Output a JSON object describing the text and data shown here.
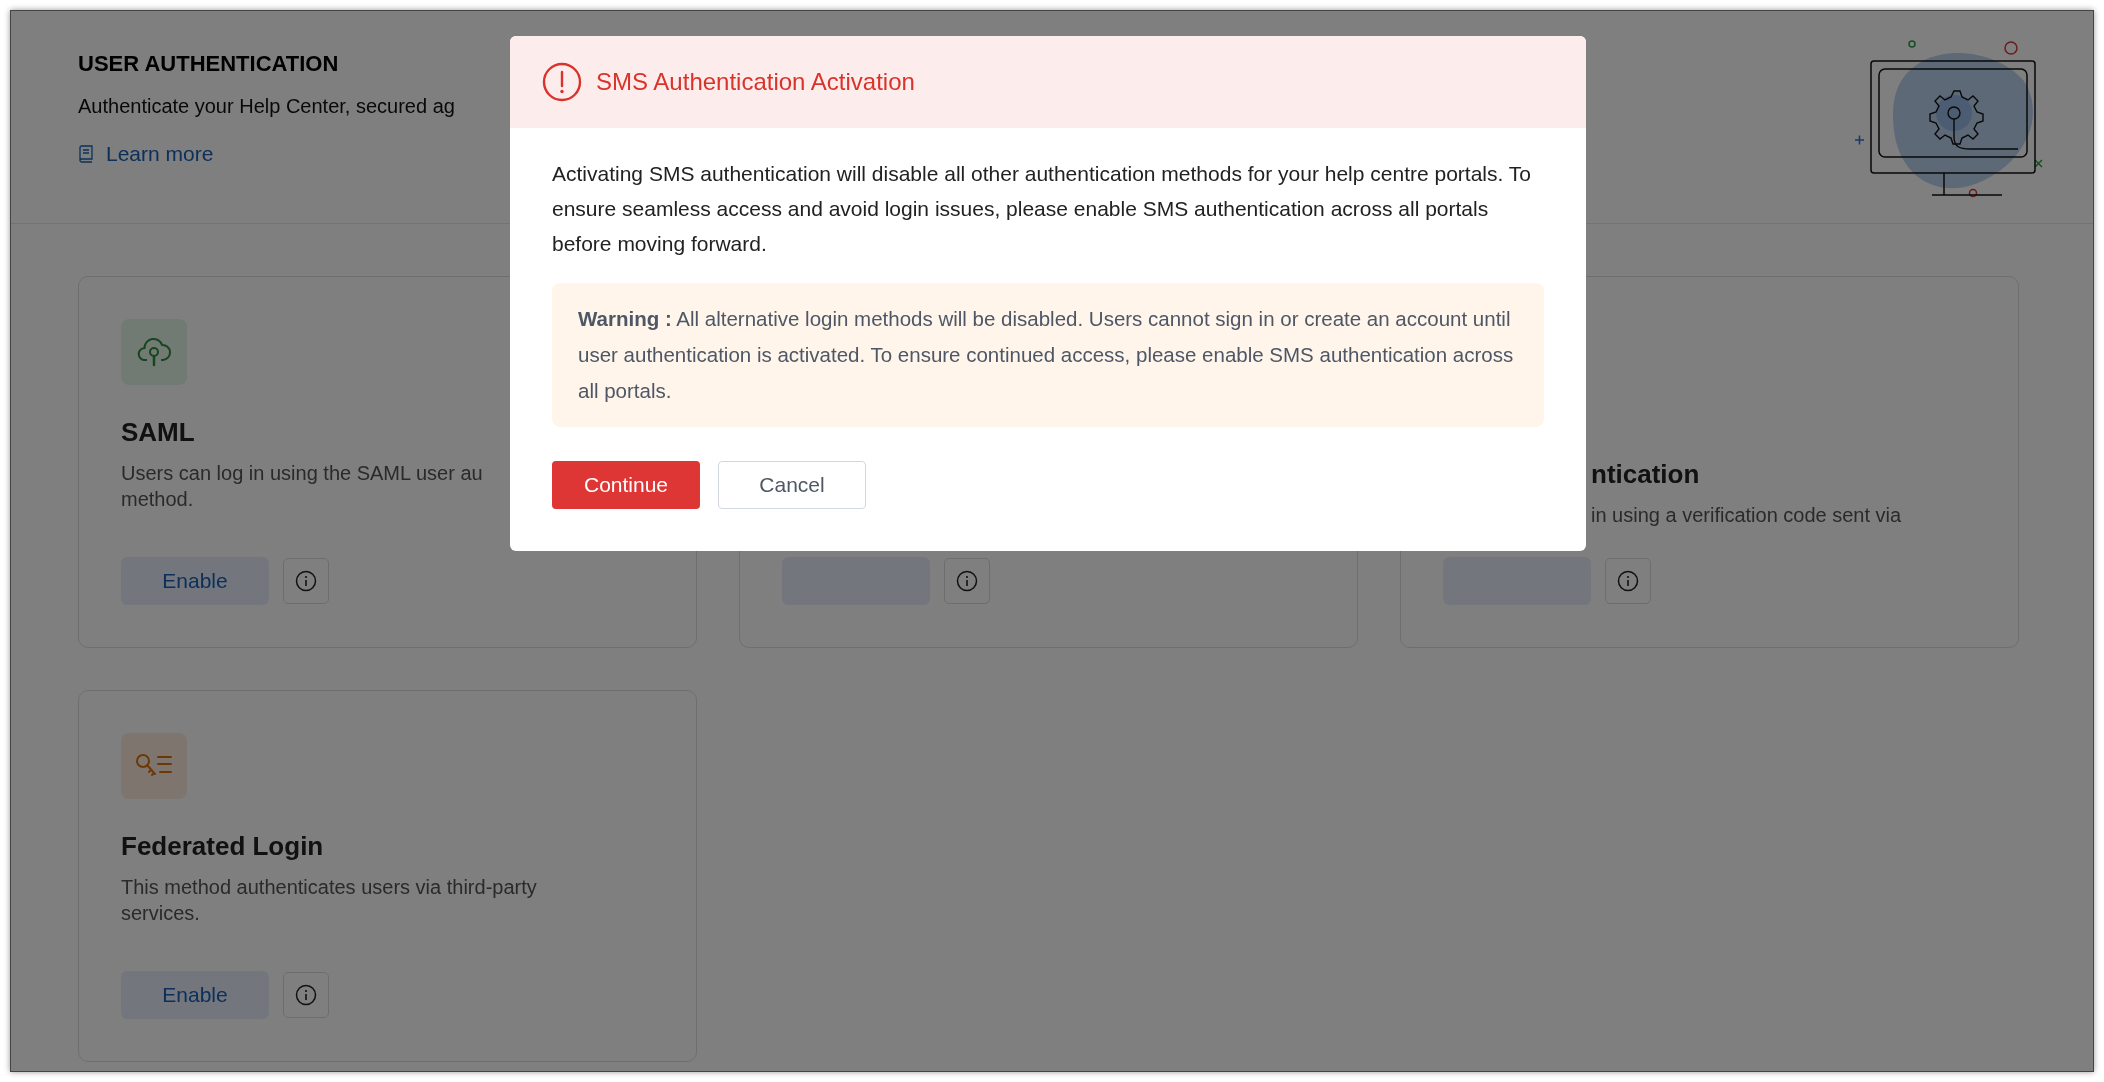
{
  "header": {
    "title": "USER AUTHENTICATION",
    "description": "Authenticate your Help Center, secured ag",
    "link": "Learn more"
  },
  "cards": [
    {
      "kind": "full",
      "title": "SAML",
      "description": [
        "Users can log in using the SAML user au",
        "method."
      ],
      "button": "Enable"
    },
    {
      "kind": "covered"
    },
    {
      "kind": "cut",
      "title": "ntication",
      "description": [
        "in using a verification code sent via"
      ]
    },
    {
      "kind": "full",
      "title": "Federated Login",
      "description": [
        "This method authenticates users via third-party services."
      ],
      "button": "Enable"
    }
  ],
  "dialog": {
    "title": "SMS Authentication Activation",
    "message": "Activating SMS authentication will disable all other authentication methods for your help centre portals. To ensure seamless access and avoid login issues, please enable SMS authentication across all portals before moving forward.",
    "warning": "**Warning :** All alternative login methods will be disabled. Users cannot sign in or create an account until user authentication is activated. To ensure continued access, please enable SMS authentication across all portals.",
    "buttons": [
      {
        "label": "Continue",
        "kind": "primary"
      },
      {
        "label": "Cancel",
        "kind": "secondary"
      }
    ]
  }
}
